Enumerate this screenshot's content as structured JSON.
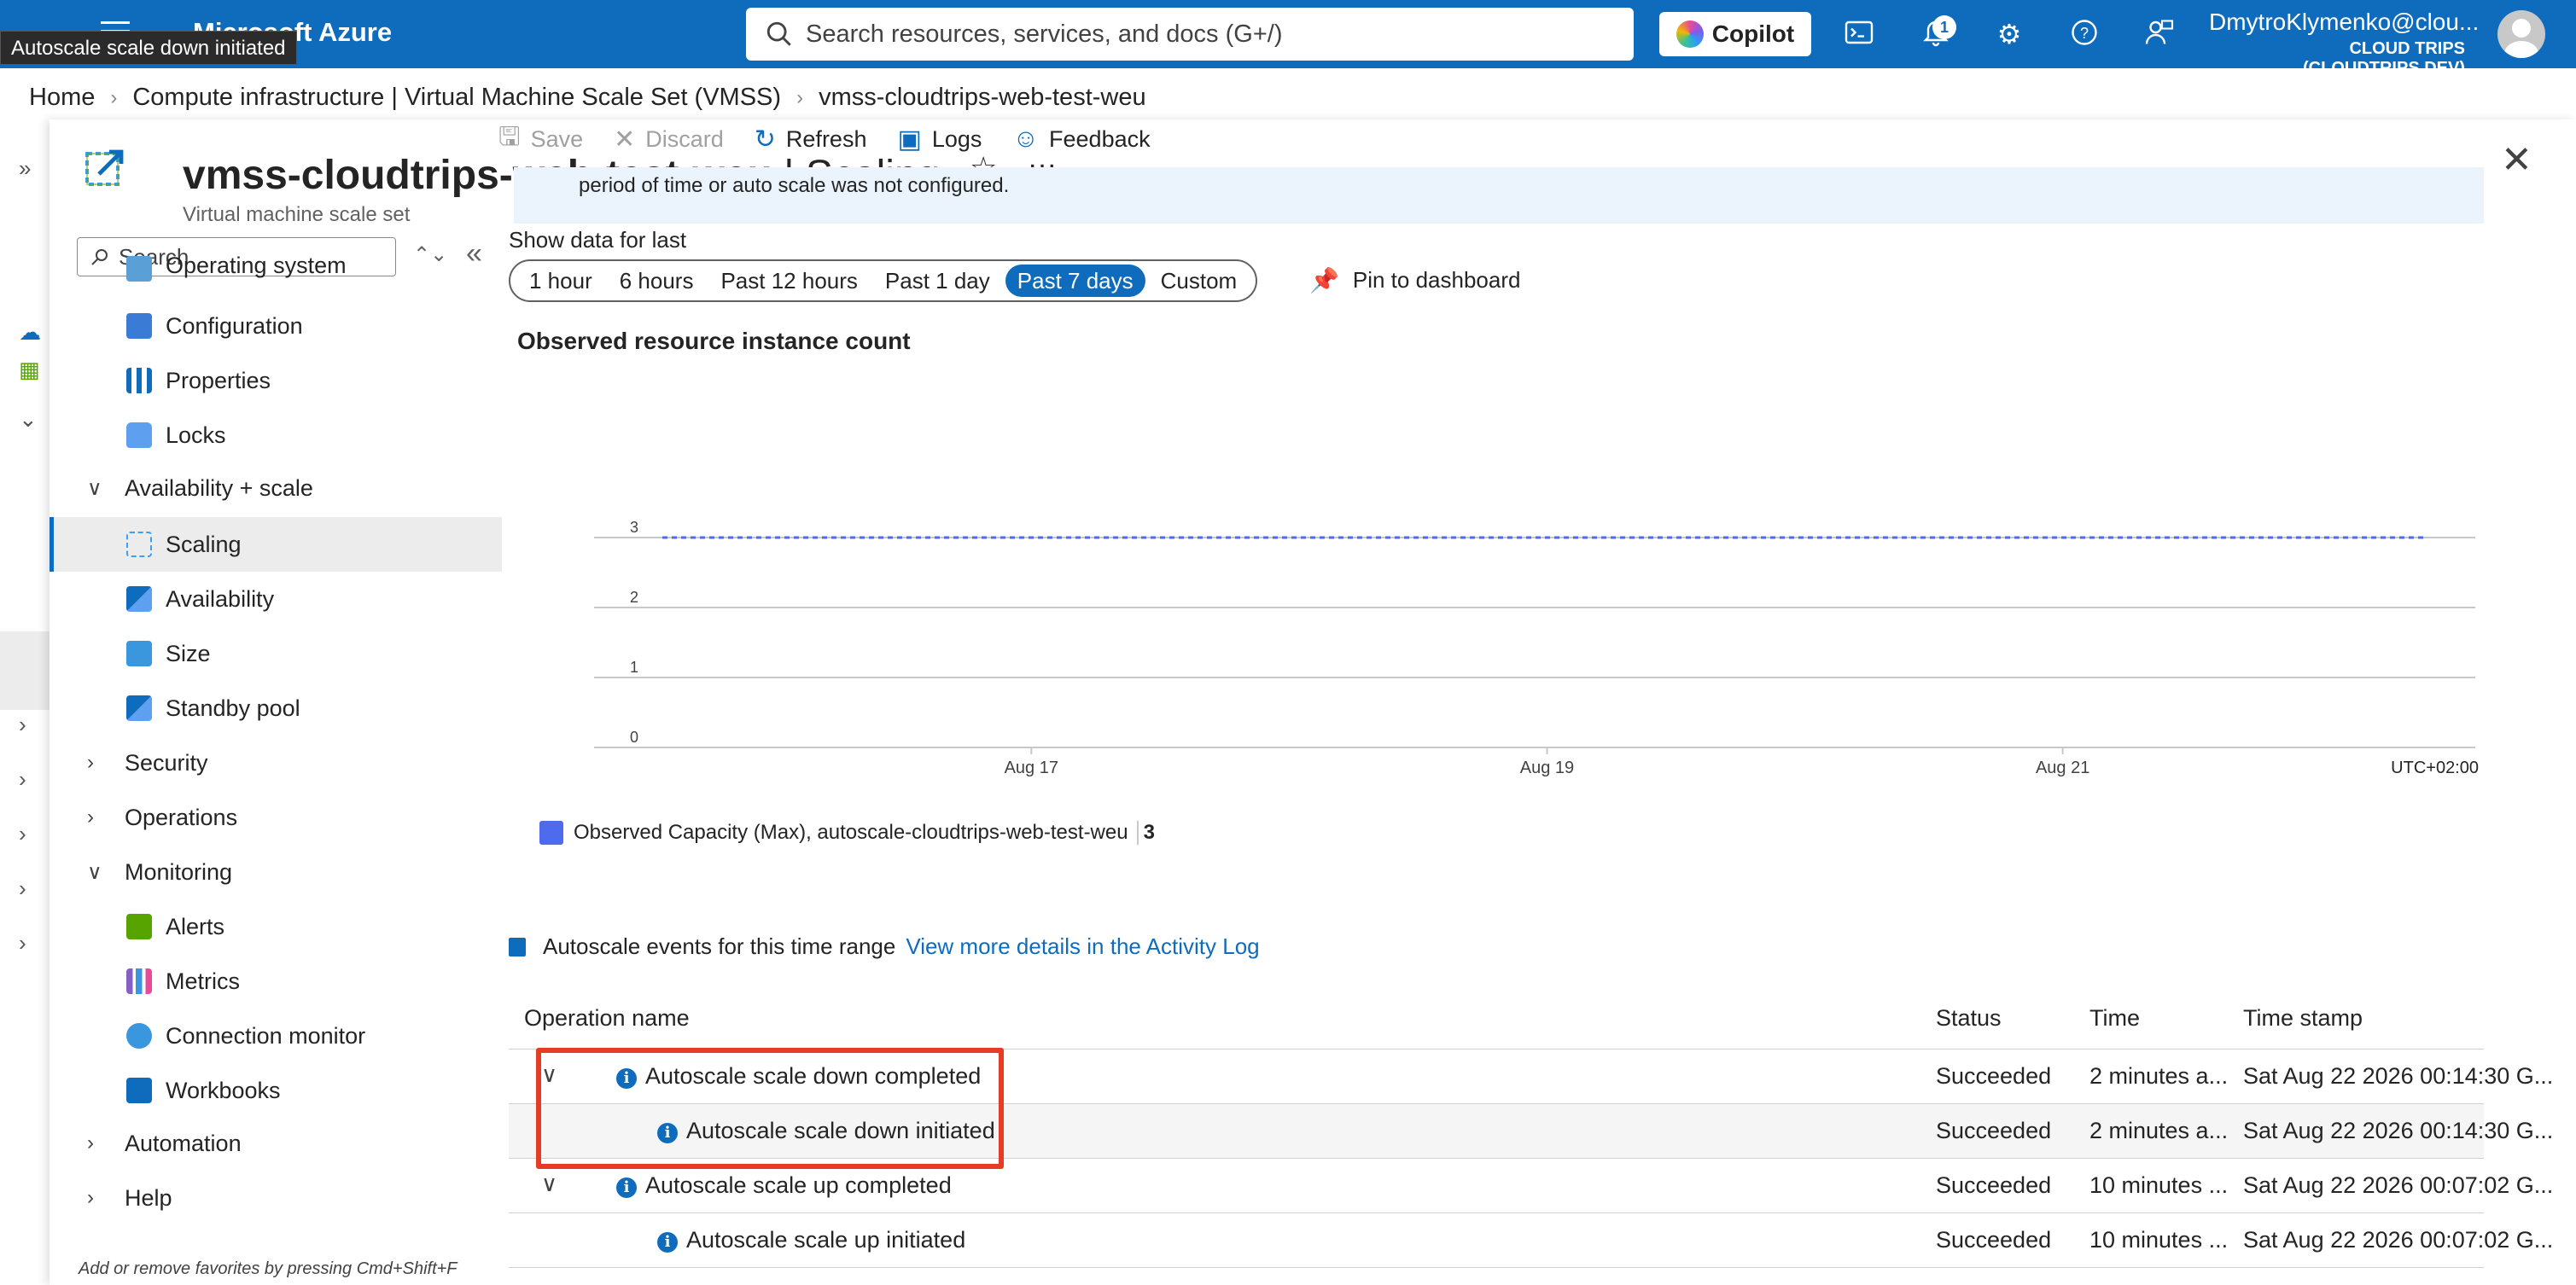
{
  "topbar": {
    "brand": "Microsoft Azure",
    "tooltip": "Autoscale scale down initiated",
    "search_placeholder": "Search resources, services, and docs (G+/)",
    "copilot_label": "Copilot",
    "notification_count": "1",
    "user_name": "DmytroKlymenko@clou...",
    "tenant": "CLOUD TRIPS (CLOUDTRIPS.DEV)"
  },
  "breadcrumb": [
    "Home",
    "Compute infrastructure | Virtual Machine Scale Set (VMSS)",
    "vmss-cloudtrips-web-test-weu"
  ],
  "blade": {
    "resource_name": "vmss-cloudtrips-web-test-weu",
    "page": "| Scaling",
    "subtitle": "Virtual machine scale set"
  },
  "menu": {
    "search_placeholder": "Search",
    "items": [
      {
        "label": "Operating system",
        "type": "item",
        "icon": "os-icon"
      },
      {
        "label": "Configuration",
        "type": "item",
        "icon": "configuration-icon"
      },
      {
        "label": "Properties",
        "type": "item",
        "icon": "properties-icon"
      },
      {
        "label": "Locks",
        "type": "item",
        "icon": "lock-icon"
      },
      {
        "label": "Availability + scale",
        "type": "group",
        "expanded": true
      },
      {
        "label": "Scaling",
        "type": "item",
        "icon": "scaling-icon",
        "active": true
      },
      {
        "label": "Availability",
        "type": "item",
        "icon": "availability-icon"
      },
      {
        "label": "Size",
        "type": "item",
        "icon": "size-icon"
      },
      {
        "label": "Standby pool",
        "type": "item",
        "icon": "standby-pool-icon"
      },
      {
        "label": "Security",
        "type": "group",
        "expanded": false
      },
      {
        "label": "Operations",
        "type": "group",
        "expanded": false
      },
      {
        "label": "Monitoring",
        "type": "group",
        "expanded": true
      },
      {
        "label": "Alerts",
        "type": "item",
        "icon": "alerts-icon"
      },
      {
        "label": "Metrics",
        "type": "item",
        "icon": "metrics-icon"
      },
      {
        "label": "Connection monitor",
        "type": "item",
        "icon": "connection-monitor-icon"
      },
      {
        "label": "Workbooks",
        "type": "item",
        "icon": "workbooks-icon"
      },
      {
        "label": "Automation",
        "type": "group",
        "expanded": false
      },
      {
        "label": "Help",
        "type": "group",
        "expanded": false
      }
    ],
    "hint": "Add or remove favorites by pressing Cmd+Shift+F"
  },
  "toolbar": {
    "save": "Save",
    "discard": "Discard",
    "refresh": "Refresh",
    "logs": "Logs",
    "feedback": "Feedback"
  },
  "info_text": "period of time or auto scale was not configured.",
  "time_range": {
    "label": "Show data for last",
    "options": [
      "1 hour",
      "6 hours",
      "Past 12 hours",
      "Past 1 day",
      "Past 7 days",
      "Custom"
    ],
    "selected": "Past 7 days",
    "pin_label": "Pin to dashboard"
  },
  "chart_data": {
    "type": "line",
    "title": "Observed resource instance count",
    "x_ticks": [
      "Aug 17",
      "Aug 19",
      "Aug 21"
    ],
    "timezone": "UTC+02:00",
    "y_ticks": [
      0,
      1,
      2,
      3
    ],
    "ylim": [
      0,
      3
    ],
    "series": [
      {
        "name": "Observed Capacity (Max), autoscale-cloudtrips-web-test-weu",
        "values": [
          3,
          3
        ],
        "style": "dashed",
        "color": "#4f6bed",
        "summary": "3"
      }
    ],
    "grid": true
  },
  "events": {
    "heading": "Autoscale events for this time range",
    "link": "View more details in the Activity Log",
    "columns": [
      "Operation name",
      "Status",
      "Time",
      "Time stamp"
    ],
    "rows": [
      {
        "name": "Autoscale scale down completed",
        "status": "Succeeded",
        "time": "2 minutes a...",
        "stamp": "Sat Aug 22 2026 00:14:30 G...",
        "parent": true
      },
      {
        "name": "Autoscale scale down initiated",
        "status": "Succeeded",
        "time": "2 minutes a...",
        "stamp": "Sat Aug 22 2026 00:14:30 G...",
        "parent": false
      },
      {
        "name": "Autoscale scale up completed",
        "status": "Succeeded",
        "time": "10 minutes ...",
        "stamp": "Sat Aug 22 2026 00:07:02 G...",
        "parent": true
      },
      {
        "name": "Autoscale scale up initiated",
        "status": "Succeeded",
        "time": "10 minutes ...",
        "stamp": "Sat Aug 22 2026 00:07:02 G...",
        "parent": false
      }
    ]
  },
  "colors": {
    "brand": "#0f6cbd",
    "highlight": "#e63b24",
    "series": "#4f6bed"
  }
}
